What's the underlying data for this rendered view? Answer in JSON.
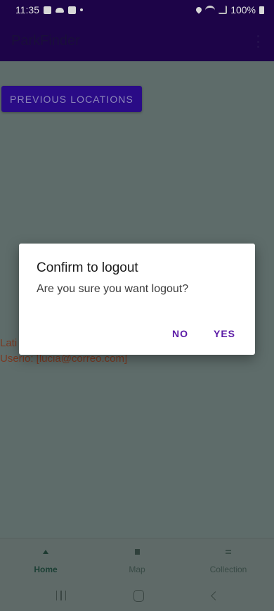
{
  "status_bar": {
    "time": "11:35",
    "battery": "100%"
  },
  "app_bar": {
    "title": "ParkFinder"
  },
  "content": {
    "previous_locations_label": "Previous locations",
    "latitude_text": "Lati",
    "user_text": "Userio: [lucia@correo.com]"
  },
  "dialog": {
    "title": "Confirm to logout",
    "message": "Are you sure you want logout?",
    "no_label": "NO",
    "yes_label": "YES"
  },
  "bottom_nav": {
    "items": [
      {
        "label": "Home",
        "icon": "home-icon",
        "selected": true
      },
      {
        "label": "Map",
        "icon": "map-icon",
        "selected": false
      },
      {
        "label": "Collection",
        "icon": "collection-icon",
        "selected": false
      }
    ]
  },
  "colors": {
    "app_bar": "#1d0448",
    "scrim_content": "#5e6c6a",
    "button": "#2a0b86",
    "dialog_action": "#5b1aa6"
  }
}
